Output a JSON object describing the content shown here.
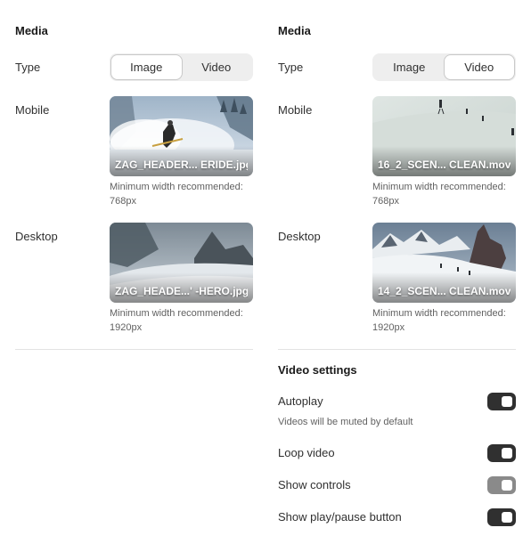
{
  "left": {
    "title": "Media",
    "type_label": "Type",
    "segments": [
      "Image",
      "Video"
    ],
    "active_segment": "Image",
    "mobile_label": "Mobile",
    "mobile_file": "ZAG_HEADER... ERIDE.jpg",
    "mobile_hint": "Minimum width recommended: 768px",
    "desktop_label": "Desktop",
    "desktop_file": "ZAG_HEADE...' -HERO.jpg",
    "desktop_hint": "Minimum width recommended: 1920px"
  },
  "right": {
    "title": "Media",
    "type_label": "Type",
    "segments": [
      "Image",
      "Video"
    ],
    "active_segment": "Video",
    "mobile_label": "Mobile",
    "mobile_file": "16_2_SCEN... CLEAN.mov",
    "mobile_hint": "Minimum width recommended: 768px",
    "desktop_label": "Desktop",
    "desktop_file": "14_2_SCEN... CLEAN.mov",
    "desktop_hint": "Minimum width recommended: 1920px"
  },
  "video_settings": {
    "title": "Video settings",
    "autoplay_label": "Autoplay",
    "autoplay_on": true,
    "autoplay_note": "Videos will be muted by default",
    "loop_label": "Loop video",
    "loop_on": true,
    "controls_label": "Show controls",
    "controls_on": false,
    "playpause_label": "Show play/pause button",
    "playpause_on": true
  },
  "colors": {
    "toggle_on": "#303030",
    "toggle_off": "#8a8a8a",
    "divider": "#e3e3e3"
  }
}
